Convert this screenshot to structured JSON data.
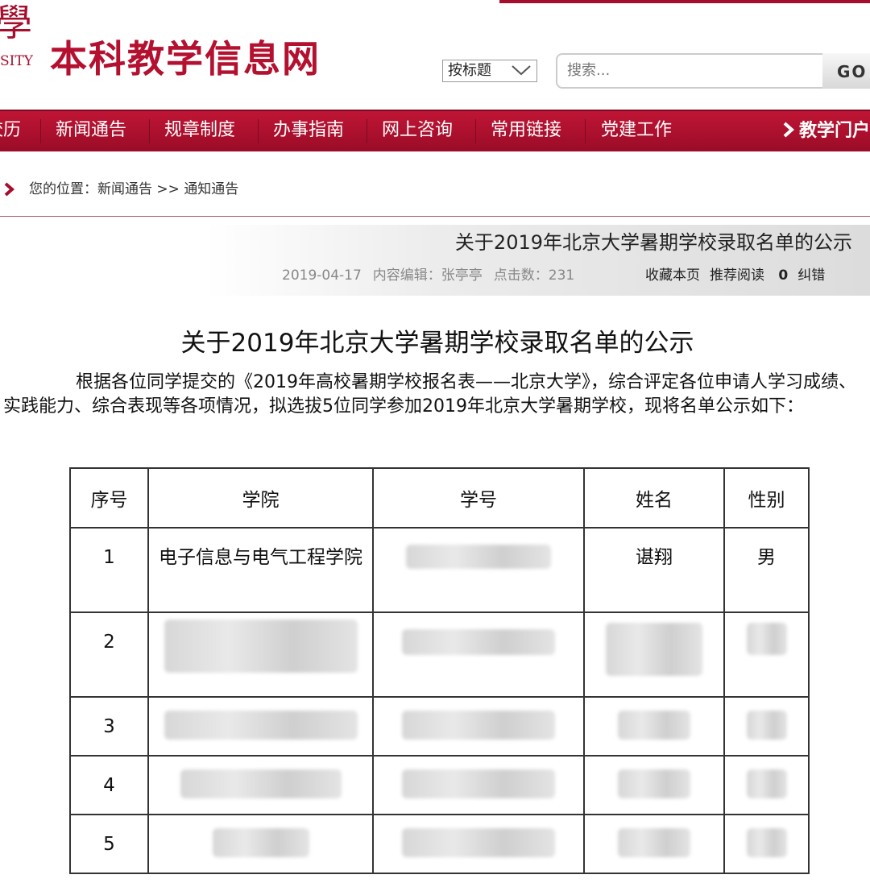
{
  "brand": {
    "logo_glyph": "學",
    "logo_sub": "SITY",
    "site_title": "本科教学信息网"
  },
  "search": {
    "scope_selected": "按标题",
    "placeholder": "搜索...",
    "go_label": "GO"
  },
  "nav": {
    "items": [
      "校历",
      "新闻通告",
      "规章制度",
      "办事指南",
      "网上咨询",
      "常用链接",
      "党建工作"
    ],
    "portal_label": "教学门户"
  },
  "breadcrumb": {
    "prefix": "您的位置：",
    "section": "新闻通告",
    "sep": ">>",
    "current": "通知通告"
  },
  "article_header": {
    "title": "关于2019年北京大学暑期学校录取名单的公示",
    "date": "2019-04-17",
    "editor": "内容编辑：张亭亭",
    "views": "点击数：231",
    "bookmark": "收藏本页",
    "recommend": "推荐阅读",
    "recommend_count": "0",
    "report": "纠错"
  },
  "article": {
    "title": "关于2019年北京大学暑期学校录取名单的公示",
    "paragraph": "根据各位同学提交的《2019年高校暑期学校报名表——北京大学》，综合评定各位申请人学习成绩、实践能力、综合表现等各项情况，拟选拔5位同学参加2019年北京大学暑期学校，现将名单公示如下："
  },
  "table": {
    "headers": [
      "序号",
      "学院",
      "学号",
      "姓名",
      "性别"
    ],
    "rows": [
      {
        "no": "1",
        "college": "电子信息与电气工程学院",
        "id": "",
        "name": "谌翔",
        "gender": "男"
      },
      {
        "no": "2",
        "college": "",
        "id": "",
        "name": "",
        "gender": ""
      },
      {
        "no": "3",
        "college": "",
        "id": "",
        "name": "",
        "gender": ""
      },
      {
        "no": "4",
        "college": "",
        "id": "",
        "name": "",
        "gender": ""
      },
      {
        "no": "5",
        "college": "",
        "id": "",
        "name": "",
        "gender": ""
      }
    ]
  },
  "colors": {
    "brand_red": "#b4102f",
    "nav_red": "#a50f2d"
  }
}
